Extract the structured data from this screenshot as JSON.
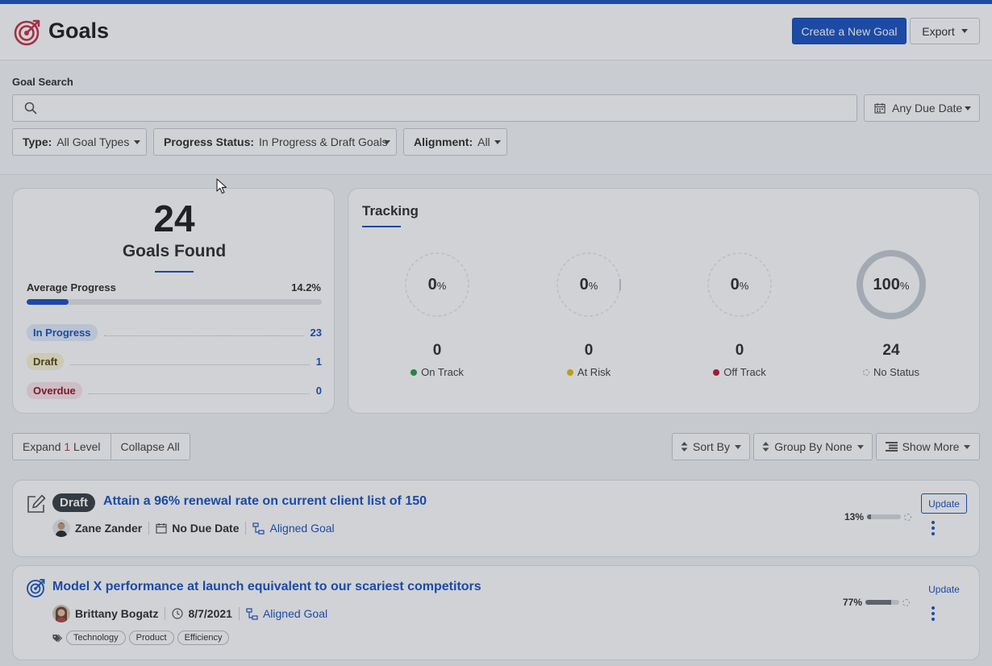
{
  "header": {
    "title": "Goals",
    "create_label": "Create a New Goal",
    "export_label": "Export"
  },
  "filters": {
    "search_label": "Goal Search",
    "search_value": "",
    "due_date_label": "Any Due Date",
    "type_key": "Type:",
    "type_value": "All Goal Types",
    "progress_key": "Progress Status:",
    "progress_value": "In Progress & Draft Goals",
    "alignment_key": "Alignment:",
    "alignment_value": "All"
  },
  "summary": {
    "count": "24",
    "count_label": "Goals Found",
    "avg_label": "Average Progress",
    "avg_value": "14.2%",
    "avg_fraction": 0.142,
    "statuses": [
      {
        "label": "In Progress",
        "count": "23"
      },
      {
        "label": "Draft",
        "count": "1"
      },
      {
        "label": "Overdue",
        "count": "0"
      }
    ]
  },
  "tracking": {
    "title": "Tracking",
    "gauges": [
      {
        "pct": "0",
        "count": "0",
        "label": "On Track",
        "color": "#2e9e46"
      },
      {
        "pct": "0",
        "count": "0",
        "label": "At Risk",
        "color": "#e4c021"
      },
      {
        "pct": "0",
        "count": "0",
        "label": "Off Track",
        "color": "#c41d3a"
      },
      {
        "pct": "100",
        "count": "24",
        "label": "No Status",
        "color": "#c7ccd4"
      }
    ]
  },
  "toolbar": {
    "expand_prefix": "Expand ",
    "expand_number": "1",
    "expand_suffix": " Level",
    "collapse_label": "Collapse All",
    "sort_label": "Sort By",
    "group_label": "Group By None",
    "show_more_label": "Show More"
  },
  "goals": [
    {
      "status_chip": "Draft",
      "title": "Attain a 96% renewal rate on current client list of 150",
      "owner": "Zane Zander",
      "due": "No Due Date",
      "alignment": "Aligned Goal",
      "progress_label": "13%",
      "progress_fraction": 0.13,
      "update_label": "Update",
      "tags": []
    },
    {
      "status_chip": "",
      "title": "Model X performance at launch equivalent to our scariest competitors",
      "owner": "Brittany Bogatz",
      "due": "8/7/2021",
      "alignment": "Aligned Goal",
      "progress_label": "77%",
      "progress_fraction": 0.77,
      "update_label": "Update",
      "tags": [
        "Technology",
        "Product",
        "Efficiency"
      ]
    }
  ],
  "colors": {
    "brand": "#1e56c4",
    "logo": "#c8344a"
  }
}
